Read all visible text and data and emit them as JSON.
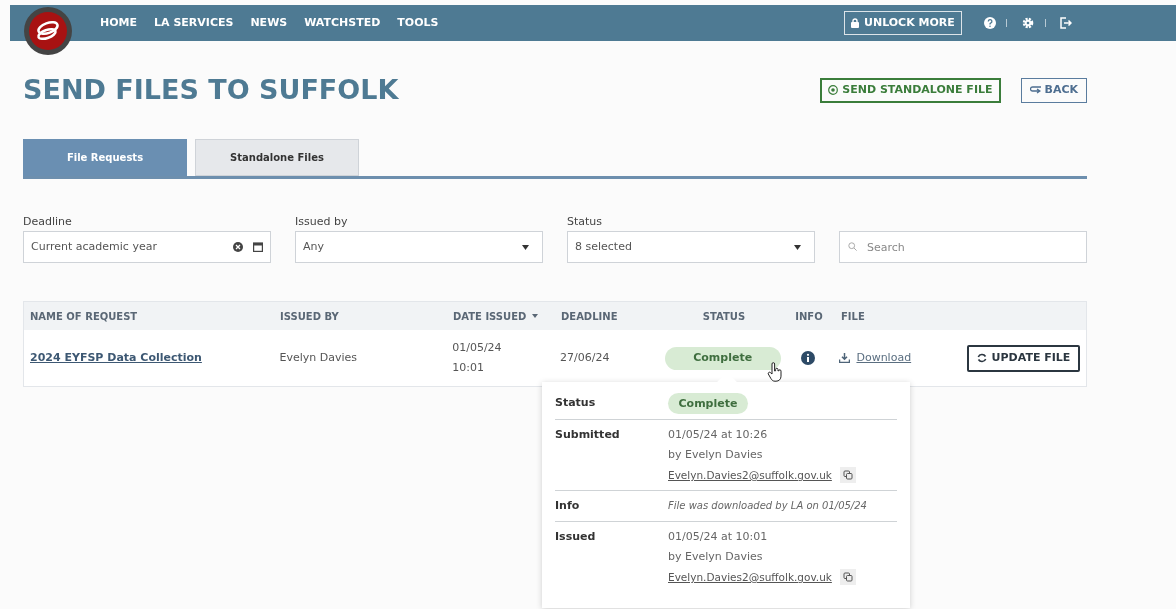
{
  "nav": {
    "links": [
      "HOME",
      "LA SERVICES",
      "NEWS",
      "WATCHSTED",
      "TOOLS"
    ],
    "unlock": "UNLOCK MORE"
  },
  "page": {
    "title": "SEND FILES TO SUFFOLK",
    "actions": [
      {
        "label": "SEND STANDALONE FILE",
        "kind": "primary"
      },
      {
        "label": "BACK",
        "kind": "back"
      }
    ]
  },
  "tabs": [
    {
      "label": "File Requests",
      "selected": true
    },
    {
      "label": "Standalone Files",
      "selected": false
    }
  ],
  "filters": [
    {
      "label": "Deadline",
      "kind": "date",
      "value": "Current academic year"
    },
    {
      "label": "Issued by",
      "kind": "select",
      "value": "Any"
    },
    {
      "label": "Status",
      "kind": "select",
      "value": "8 selected"
    },
    {
      "kind": "search",
      "placeholder": "Search"
    }
  ],
  "table": {
    "columns": [
      {
        "label": "NAME OF REQUEST",
        "sorted": false
      },
      {
        "label": "ISSUED BY",
        "sorted": false
      },
      {
        "label": "DATE ISSUED",
        "sorted": true
      },
      {
        "label": "DEADLINE",
        "sorted": false
      },
      {
        "label": "STATUS",
        "sorted": false
      },
      {
        "label": "INFO",
        "sorted": false
      },
      {
        "label": "FILE",
        "sorted": false
      }
    ],
    "rows": [
      {
        "name": "2024 EYFSP Data Collection",
        "issued_by": "Evelyn Davies",
        "date_issued": [
          "01/05/24",
          "10:01"
        ],
        "deadline": "27/06/24",
        "status": "Complete",
        "file": "Download",
        "action": "UPDATE FILE"
      }
    ]
  },
  "popover": {
    "rows": [
      {
        "label": "Status",
        "kind": "badge",
        "value": "Complete"
      },
      {
        "label": "Submitted",
        "kind": "details",
        "lines": [
          "01/05/24 at 10:26",
          "by Evelyn Davies"
        ],
        "email": "Evelyn.Davies2@suffolk.gov.uk"
      },
      {
        "label": "Info",
        "kind": "note",
        "value": "File was downloaded by LA on 01/05/24"
      },
      {
        "label": "Issued",
        "kind": "details",
        "lines": [
          "01/05/24 at 10:01",
          "by Evelyn Davies"
        ],
        "email": "Evelyn.Davies2@suffolk.gov.uk"
      }
    ]
  }
}
